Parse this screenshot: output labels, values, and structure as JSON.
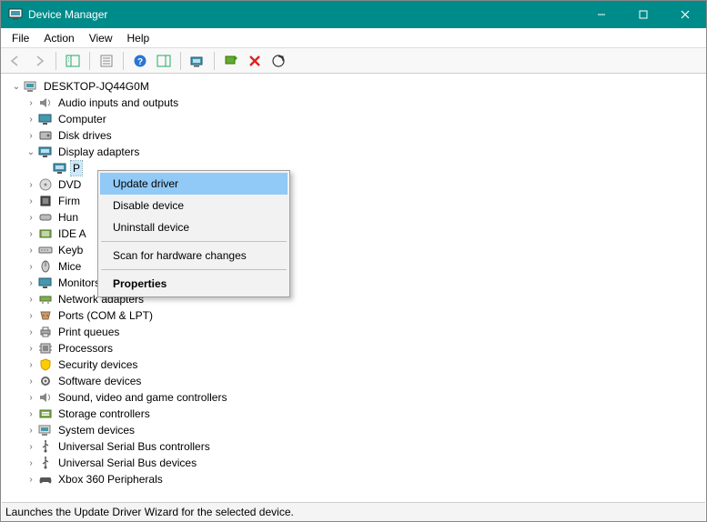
{
  "window": {
    "title": "Device Manager"
  },
  "menubar": {
    "file": "File",
    "action": "Action",
    "view": "View",
    "help": "Help"
  },
  "statusbar": {
    "text": "Launches the Update Driver Wizard for the selected device."
  },
  "tree": {
    "root": "DESKTOP-JQ44G0M",
    "audio": "Audio inputs and outputs",
    "computer": "Computer",
    "disk": "Disk drives",
    "display": "Display adapters",
    "display_child": "P",
    "dvd": "DVD",
    "firm": "Firm",
    "hum": "Hun",
    "ide": "IDE A",
    "key": "Keyb",
    "mice": "Mice",
    "monitors": "Monitors",
    "network": "Network adapters",
    "ports": "Ports (COM & LPT)",
    "printq": "Print queues",
    "processors": "Processors",
    "security": "Security devices",
    "software": "Software devices",
    "sound": "Sound, video and game controllers",
    "storage": "Storage controllers",
    "system": "System devices",
    "usb_ctrl": "Universal Serial Bus controllers",
    "usb_dev": "Universal Serial Bus devices",
    "xbox": "Xbox 360 Peripherals"
  },
  "context_menu": {
    "update": "Update driver",
    "disable": "Disable device",
    "uninstall": "Uninstall device",
    "scan": "Scan for hardware changes",
    "properties": "Properties"
  }
}
